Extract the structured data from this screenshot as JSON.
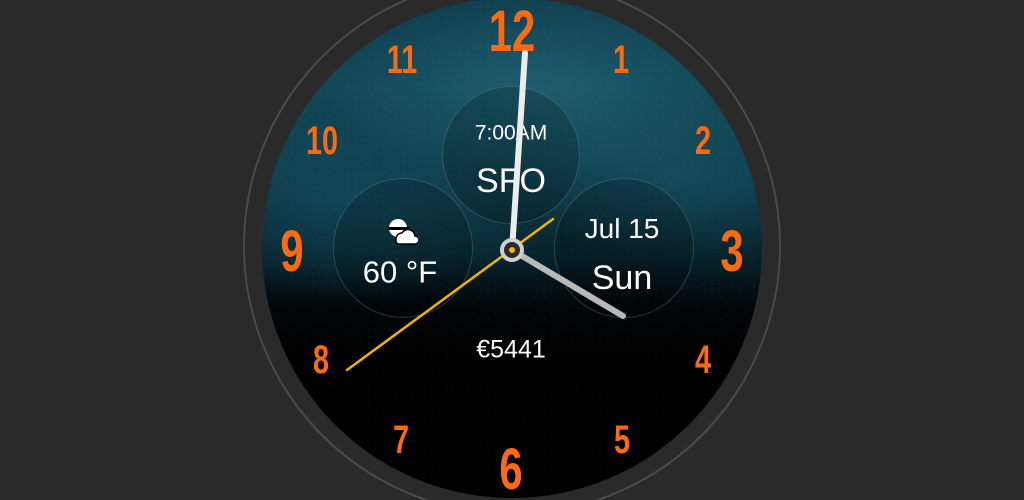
{
  "watch": {
    "numerals": [
      "12",
      "1",
      "2",
      "3",
      "4",
      "5",
      "6",
      "7",
      "8",
      "9",
      "10",
      "11"
    ],
    "top_complication": {
      "time": "7:00AM",
      "city": "SFO"
    },
    "left_complication": {
      "icon": "weather-cloud-sun-icon",
      "temperature": "60 °F"
    },
    "right_complication": {
      "date": "Jul 15",
      "day": "Sun"
    },
    "bottom_complication": {
      "value": "€5441"
    },
    "colors": {
      "numerals": "#ff6a10",
      "hands": "#e8e8e8",
      "second_hand": "#f2b400",
      "background": "#2a2a2a"
    }
  }
}
